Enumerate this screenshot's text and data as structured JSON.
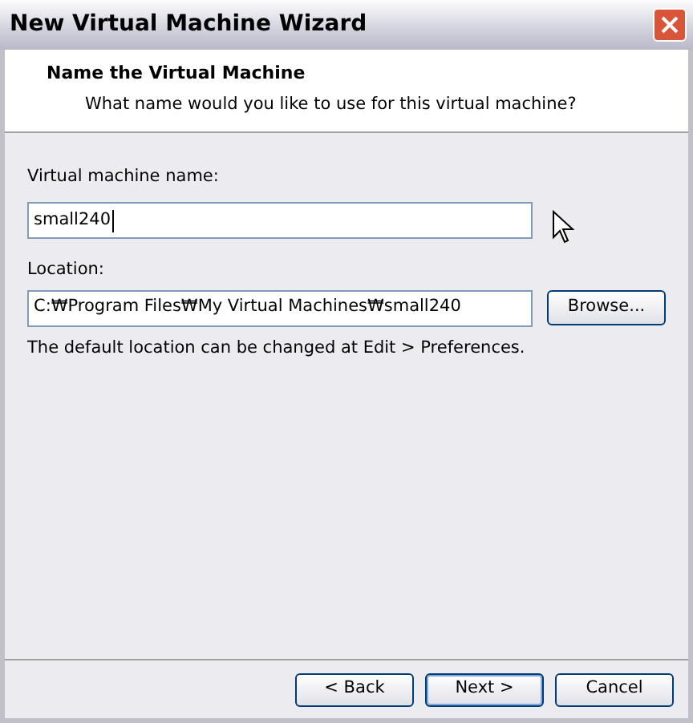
{
  "window": {
    "title": "New Virtual Machine Wizard"
  },
  "header": {
    "title": "Name the Virtual Machine",
    "subtitle": "What name would you like to use for this virtual machine?"
  },
  "fields": [
    {
      "label": "Virtual machine name:",
      "value": "small240",
      "focused": true
    },
    {
      "label": "Location:",
      "value": "C:₩Program Files₩My Virtual Machines₩small240",
      "focused": false,
      "button": "Browse..."
    }
  ],
  "note": "The default location can be changed at Edit > Preferences.",
  "buttons": [
    {
      "label": "< Back",
      "default": false
    },
    {
      "label": "Next >",
      "default": true
    },
    {
      "label": "Cancel",
      "default": false
    }
  ]
}
